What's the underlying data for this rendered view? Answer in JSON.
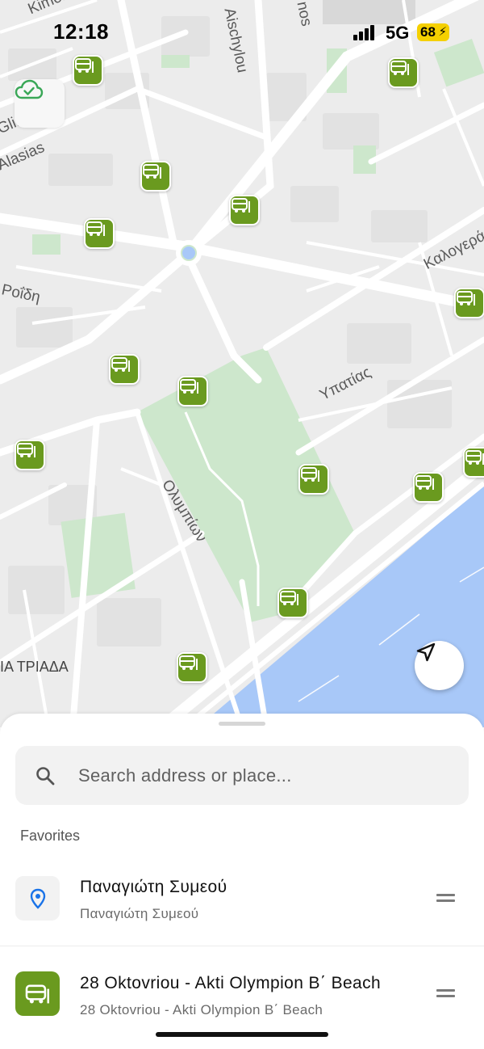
{
  "status_bar": {
    "time": "12:18",
    "network": "5G",
    "battery": "68"
  },
  "map": {
    "labels": [
      {
        "text": "Kimonos"
      },
      {
        "text": "Aischylou"
      },
      {
        "text": "nos"
      },
      {
        "text": "Glin"
      },
      {
        "text": "Alasias"
      },
      {
        "text": "Καλογερά"
      },
      {
        "text": "Ροΐδη"
      },
      {
        "text": "Υπατίας"
      },
      {
        "text": "Ολυμπίων"
      },
      {
        "text": "ΙΑ ΤΡΙΑΔΑ"
      }
    ],
    "bus_stop_icon": "bus-stop-icon",
    "bus_stop_color": "#6a9a1f",
    "park_color": "#cde7cc",
    "sea_color": "#a8c8f8"
  },
  "controls": {
    "sync_icon": "cloud-check-icon",
    "locate_icon": "navigation-arrow-icon"
  },
  "sheet": {
    "search_placeholder": "Search address or place...",
    "favorites_header": "Favorites",
    "favorites": [
      {
        "title": "Παναγιώτη Συμεού",
        "subtitle": "Παναγιώτη Συμεού",
        "icon": "location-pin-icon"
      },
      {
        "title": "28 Oktovriou - Akti Olympion B΄ Beach",
        "subtitle": "28 Oktovriou - Akti Olympion B΄ Beach",
        "icon": "bus-stop-icon"
      }
    ]
  }
}
